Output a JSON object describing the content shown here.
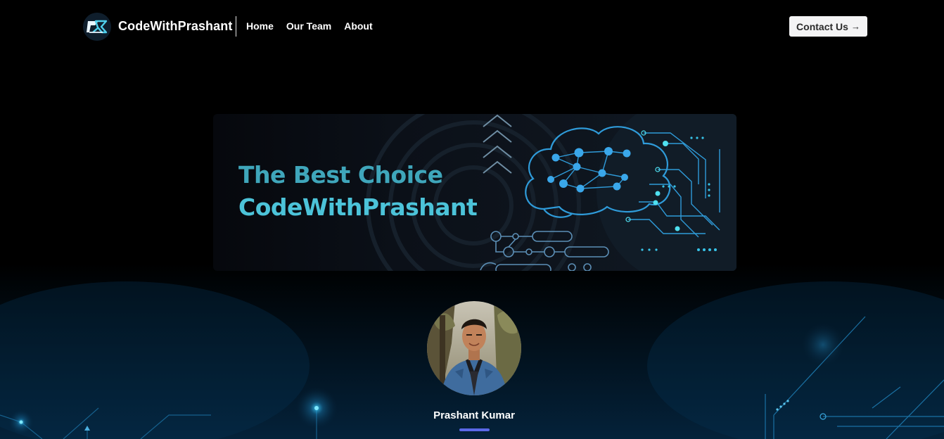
{
  "navbar": {
    "brand_name": "CodeWithPrashant",
    "links": [
      {
        "label": "Home"
      },
      {
        "label": "Our Team"
      },
      {
        "label": "About"
      }
    ],
    "contact_button": {
      "label": "Contact Us",
      "icon": "arrow-right-icon"
    }
  },
  "banner": {
    "line1": "The Best Choice",
    "line2": "CodeWithPrashant"
  },
  "profile": {
    "name": "Prashant Kumar"
  },
  "colors": {
    "background": "#000000",
    "banner_text_1": "#3fa6bb",
    "banner_text_2": "#4cc3d9",
    "accent_underline": "#5b68e8",
    "contact_button_bg": "#f4f4f5"
  }
}
